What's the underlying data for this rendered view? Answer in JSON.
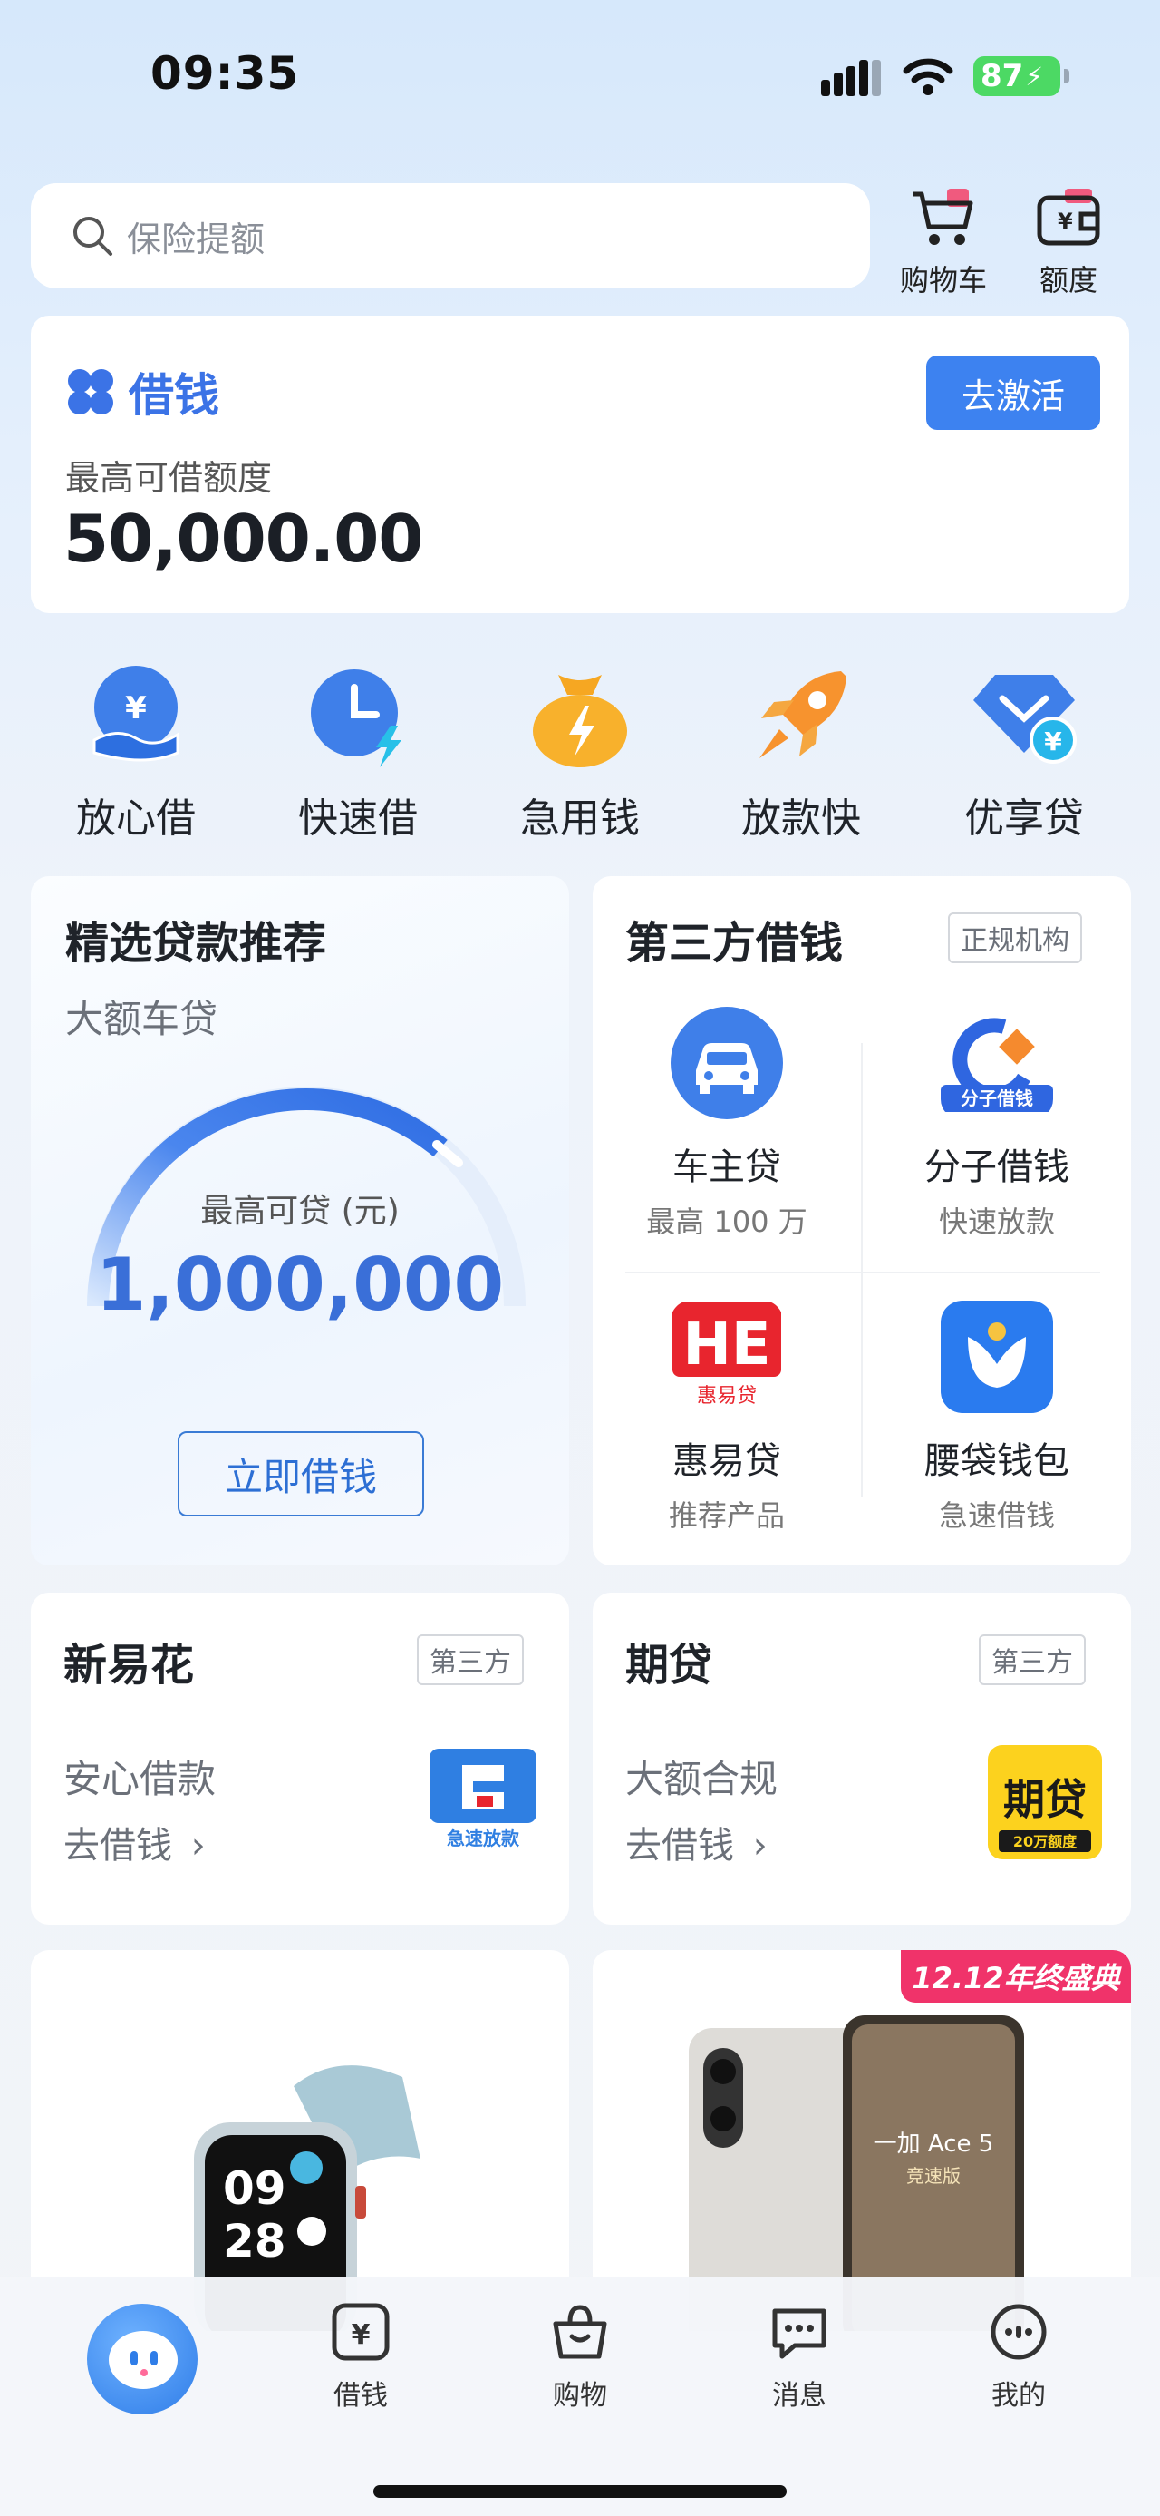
{
  "status": {
    "time": "09:35",
    "battery": "87"
  },
  "search": {
    "placeholder": "保险提额"
  },
  "top_icons": {
    "cart": "购物车",
    "limit": "额度"
  },
  "borrow": {
    "title": "借钱",
    "activate": "去激活",
    "limit_label": "最高可借额度",
    "limit_amount": "50,000.00"
  },
  "quick": [
    {
      "label": "放心借",
      "icon": "yuan-hand-icon"
    },
    {
      "label": "快速借",
      "icon": "clock-lightning-icon"
    },
    {
      "label": "急用钱",
      "icon": "money-bag-icon"
    },
    {
      "label": "放款快",
      "icon": "rocket-icon"
    },
    {
      "label": "优享贷",
      "icon": "diamond-yuan-icon"
    }
  ],
  "recommend": {
    "title": "精选贷款推荐",
    "subtitle": "大额车贷",
    "max_label": "最高可贷 (元)",
    "max_amount": "1,000,000",
    "button": "立即借钱"
  },
  "third_party": {
    "title": "第三方借钱",
    "tag": "正规机构",
    "items": [
      {
        "name": "车主贷",
        "sub": "最高 100 万"
      },
      {
        "name": "分子借钱",
        "sub": "快速放款",
        "logo_text": "分子借钱"
      },
      {
        "name": "惠易贷",
        "sub": "推荐产品",
        "logo_text": "惠易贷"
      },
      {
        "name": "腰袋钱包",
        "sub": "急速借钱"
      }
    ]
  },
  "xinyihua": {
    "title": "新易花",
    "tag": "第三方",
    "sub": "安心借款",
    "link": "去借钱",
    "logo_text": "急速放款"
  },
  "qihuo": {
    "title": "期贷",
    "tag": "第三方",
    "sub": "大额合规",
    "link": "去借钱",
    "logo_text": "期贷",
    "logo_sub": "20万额度"
  },
  "products": {
    "watch_time_h": "09",
    "watch_time_m": "28",
    "promo": "12.12年终盛典",
    "phone_text": "一加 Ace 5",
    "phone_sub": "竞速版"
  },
  "tabs": [
    {
      "label": "借钱"
    },
    {
      "label": "购物"
    },
    {
      "label": "消息"
    },
    {
      "label": "我的"
    }
  ],
  "colors": {
    "accent": "#3d82f0",
    "promo": "#f0336a"
  }
}
